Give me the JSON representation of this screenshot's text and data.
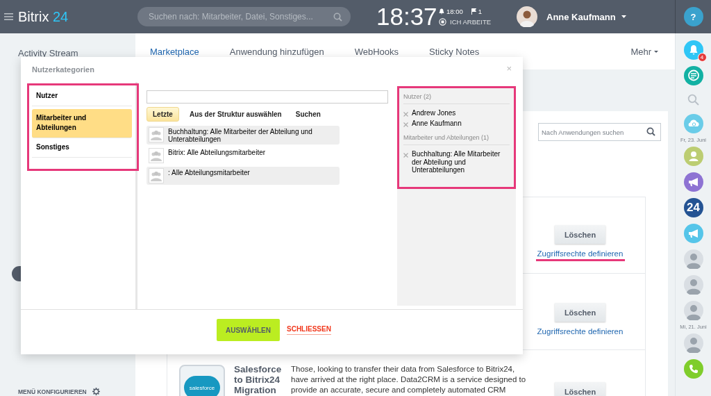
{
  "header": {
    "logo_main": "Bitrix",
    "logo_accent": "24",
    "search": {
      "placeholder": "Suchen nach: Mitarbeiter, Datei, Sonstiges..."
    },
    "clock": "18:37",
    "alarm": "18:00",
    "flags": "1",
    "work_status": "ICH ARBEITE",
    "user": "Anne Kaufmann",
    "help": "?"
  },
  "sidebar": {
    "items": [
      {
        "kind": "text",
        "label": "Activity Stream"
      },
      {
        "kind": "counter"
      }
    ],
    "configure": "MENÜ KONFIGURIEREN"
  },
  "tabs": [
    {
      "label": "Marketplace",
      "selected": true
    },
    {
      "label": "Anwendung hinzufügen",
      "selected": false
    },
    {
      "label": "WebHooks",
      "selected": false
    },
    {
      "label": "Sticky Notes",
      "selected": false
    }
  ],
  "more": "Mehr",
  "app_search": {
    "placeholder": "Nach Anwendungen suchen"
  },
  "apps": [
    {
      "delete": "Löschen",
      "access": "Zugriffsrechte definieren",
      "access_highlighted": true
    },
    {
      "delete": "Löschen",
      "access": "Zugriffsrechte definieren",
      "access_highlighted": false
    },
    {
      "logo": "salesforce",
      "title": "Salesforce to Bitrix24 Migration",
      "description": "Those, looking to transfer their data from Salesforce to Bitrix24, have arrived at the right place. Data2CRM is a service designed to provide an accurate, secure and completely automated CRM",
      "delete": "Löschen"
    }
  ],
  "dialog": {
    "title": "Nutzerkategorien",
    "close": "×",
    "categories_highlighted": true,
    "categories": [
      {
        "label": "Nutzer",
        "selected": false
      },
      {
        "label": "Mitarbeiter und Abteilungen",
        "selected": true
      },
      {
        "label": "Sonstiges",
        "selected": false
      }
    ],
    "source_tabs": [
      {
        "label": "Letzte",
        "selected": true
      },
      {
        "label": "Aus der Struktur auswählen",
        "selected": false
      },
      {
        "label": "Suchen",
        "selected": false
      }
    ],
    "results": [
      {
        "label": "Buchhaltung: Alle Mitarbeiter der Abteilung und Unterabteilungen",
        "highlighted": true
      },
      {
        "label": "Bitrix: Alle Abteilungsmitarbeiter",
        "highlighted": false
      },
      {
        "label": ": Alle Abteilungsmitarbeiter",
        "highlighted": true
      }
    ],
    "selection_highlighted": true,
    "selection": [
      {
        "heading": "Nutzer (2)",
        "items": [
          "Andrew Jones",
          "Anne Kaufmann"
        ]
      },
      {
        "heading": "Mitarbeiter und Abteilungen (1)",
        "items": [
          "Buchhaltung: Alle Mitarbeiter der Abteilung und Unterabteilungen"
        ]
      }
    ],
    "confirm": "AUSWÄHLEN",
    "cancel": "SCHLIESSEN"
  },
  "rail": [
    {
      "kind": "bell",
      "color": "#2fc6f6",
      "badge": "4"
    },
    {
      "kind": "chat",
      "color": "#12b1a3"
    },
    {
      "kind": "search"
    },
    {
      "kind": "cloud",
      "color": "#6acce8"
    },
    {
      "kind": "date",
      "label": "Fr, 23. Juni"
    },
    {
      "kind": "person",
      "color": "#bccd72"
    },
    {
      "kind": "megaphone",
      "color": "#8e73d3"
    },
    {
      "kind": "text",
      "color": "#245393",
      "label": "24"
    },
    {
      "kind": "megaphone",
      "color": "#55c5e9"
    },
    {
      "kind": "avatar"
    },
    {
      "kind": "avatar"
    },
    {
      "kind": "avatar"
    },
    {
      "kind": "date",
      "label": "Mi, 21. Juni"
    },
    {
      "kind": "avatar"
    },
    {
      "kind": "phone",
      "color": "#7fcd2b"
    }
  ]
}
